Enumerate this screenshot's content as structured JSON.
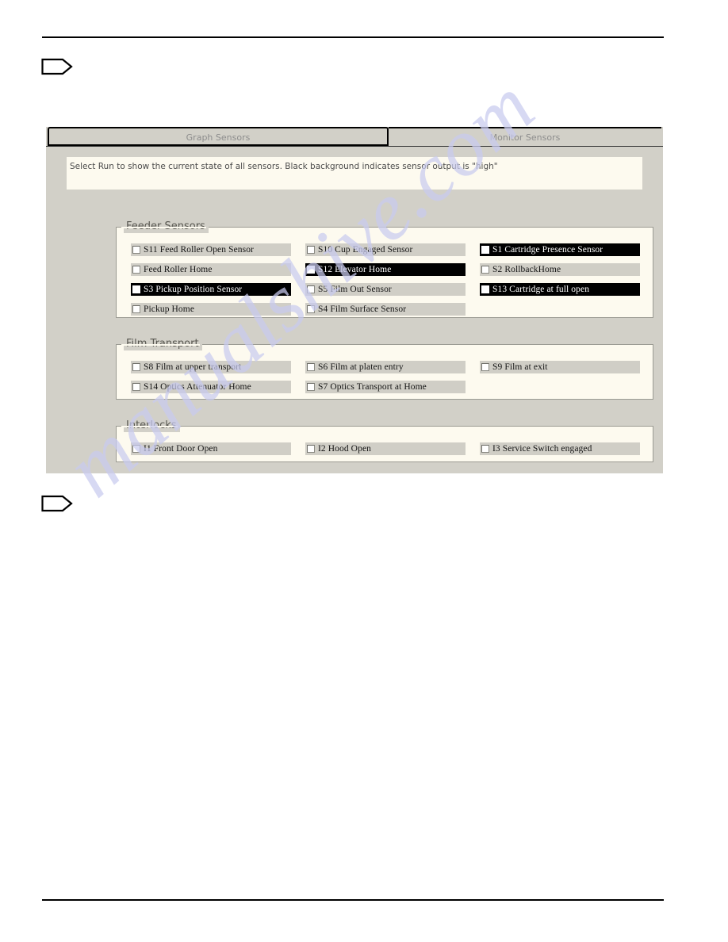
{
  "page": {
    "watermark": "manualshive.com"
  },
  "dialog": {
    "tabs": [
      {
        "label": "Graph Sensors",
        "active": false
      },
      {
        "label": "Monitor Sensors",
        "active": true
      }
    ],
    "instruction": "Select Run to show the current state of all sensors. Black background indicates sensor output is \"high\"",
    "groups": [
      {
        "title": "Feeder Sensors",
        "columns": [
          [
            {
              "label": "S11 Feed Roller Open Sensor",
              "state": "low",
              "checked": false
            },
            {
              "label": "Feed Roller Home",
              "state": "low",
              "checked": false
            },
            {
              "label": "S3 Pickup Position Sensor",
              "state": "high",
              "checked": false
            },
            {
              "label": "Pickup Home",
              "state": "low",
              "checked": false
            }
          ],
          [
            {
              "label": "S10 Cup Engaged Sensor",
              "state": "low",
              "checked": false
            },
            {
              "label": "S12 Elevator Home",
              "state": "high",
              "checked": false
            },
            {
              "label": "S5 Film Out Sensor",
              "state": "low",
              "checked": false
            },
            {
              "label": "S4 Film Surface Sensor",
              "state": "low",
              "checked": false
            }
          ],
          [
            {
              "label": "S1 Cartridge Presence Sensor",
              "state": "high",
              "checked": false
            },
            {
              "label": "S2 RollbackHome",
              "state": "low",
              "checked": false
            },
            {
              "label": "S13 Cartridge at full open",
              "state": "high",
              "checked": false
            }
          ]
        ]
      },
      {
        "title": "Film Transport",
        "columns": [
          [
            {
              "label": "S8 Film at upper transport",
              "state": "low",
              "checked": false
            },
            {
              "label": "S14 Optics Attenuator Home",
              "state": "low",
              "checked": false
            }
          ],
          [
            {
              "label": "S6 Film at platen entry",
              "state": "low",
              "checked": false
            },
            {
              "label": "S7 Optics Transport at Home",
              "state": "low",
              "checked": false
            }
          ],
          [
            {
              "label": "S9 Film at exit",
              "state": "low",
              "checked": false
            }
          ]
        ]
      },
      {
        "title": "Interlocks",
        "columns": [
          [
            {
              "label": "I1 Front Door Open",
              "state": "low",
              "checked": false
            }
          ],
          [
            {
              "label": "I2 Hood Open",
              "state": "low",
              "checked": false
            }
          ],
          [
            {
              "label": "I3 Service Switch engaged",
              "state": "low",
              "checked": false
            }
          ]
        ]
      }
    ]
  },
  "colors": {
    "dialog_face": "#d2d0c8",
    "group_face": "#fdfaef",
    "row_low": "#d0cec6",
    "row_high": "#000000",
    "watermark": "#c9cbef"
  }
}
